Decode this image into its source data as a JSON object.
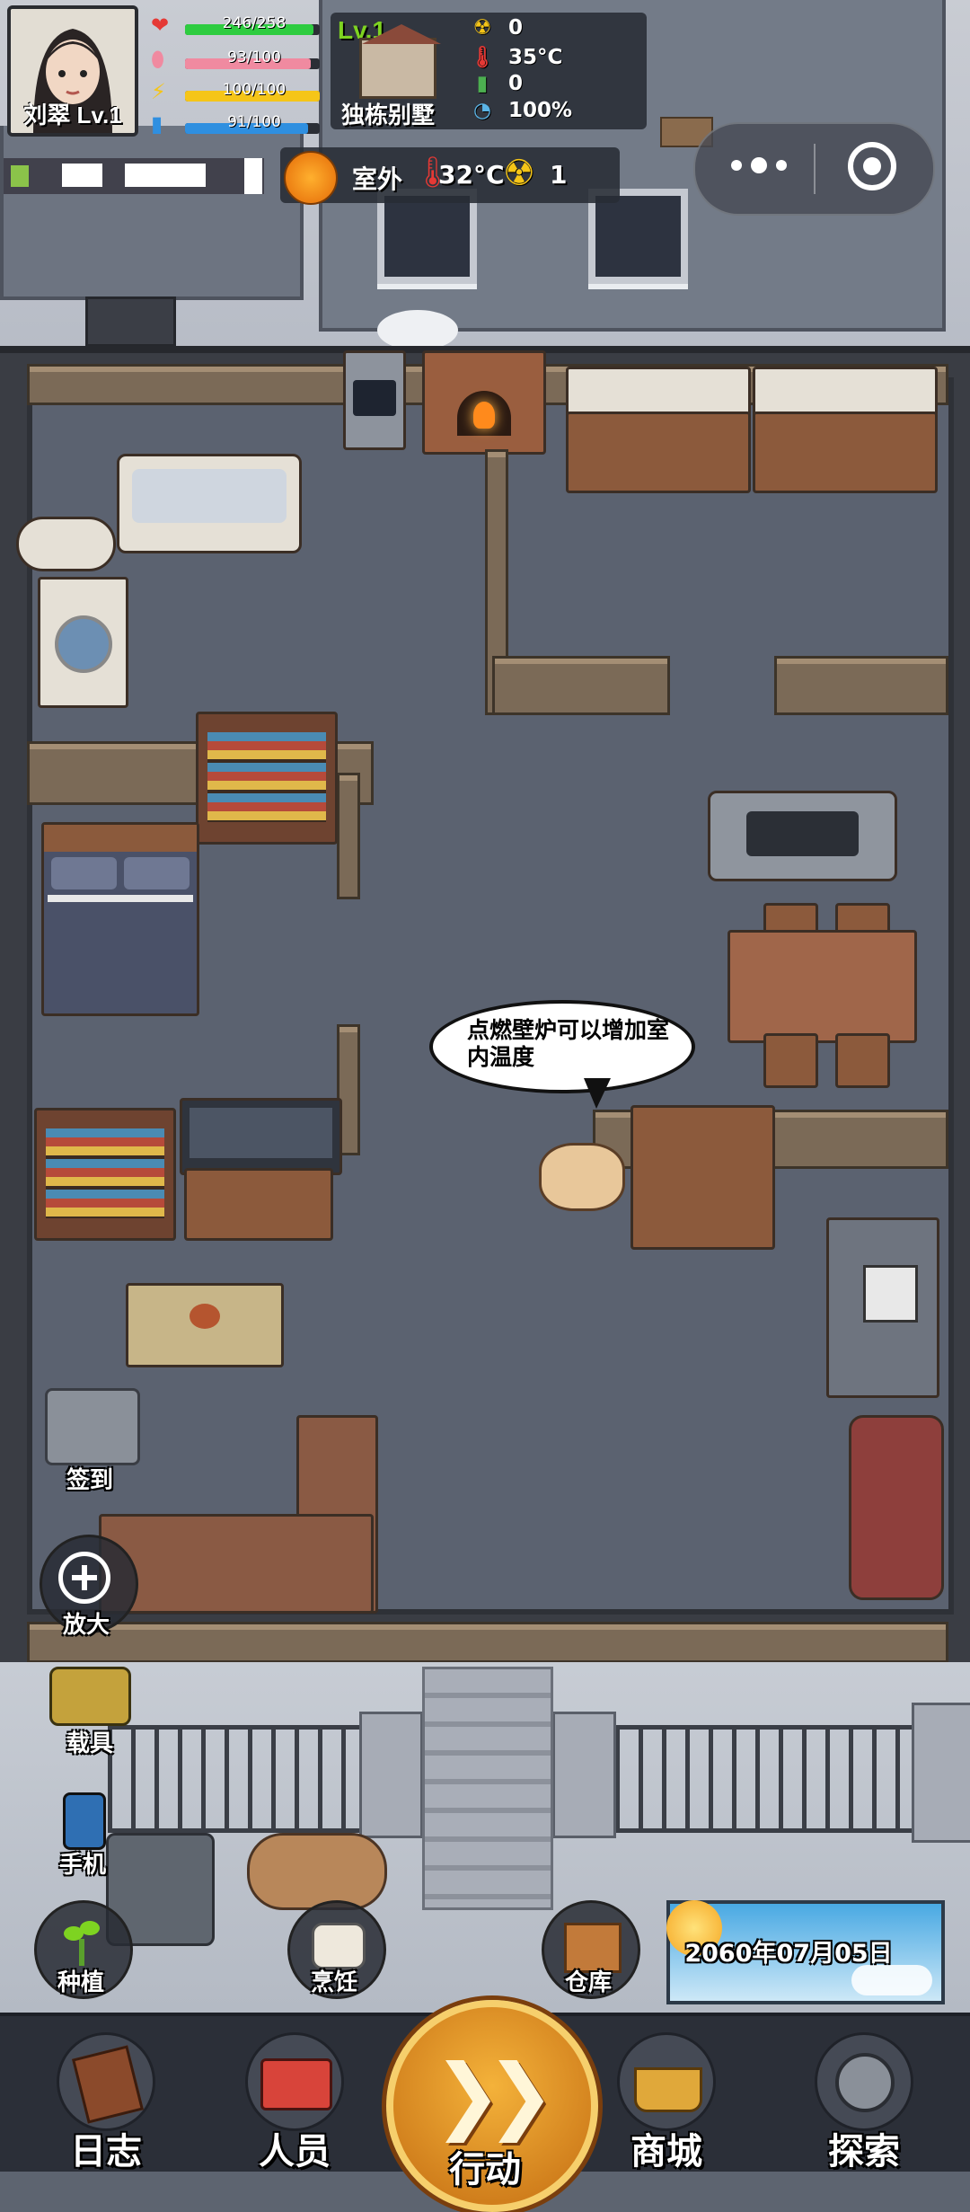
{
  "player": {
    "name_level": "刘翠 Lv.1",
    "stats": [
      {
        "icon": "heart-icon",
        "glyph": "❤",
        "text": "246/258",
        "fraction": 0.953,
        "color": "#2ecc40"
      },
      {
        "icon": "stomach-icon",
        "glyph": "🫃",
        "text": "93/100",
        "fraction": 0.93,
        "color": "#f08aa0"
      },
      {
        "icon": "energy-icon",
        "glyph": "⚡",
        "text": "100/100",
        "fraction": 1.0,
        "color": "#f5c518"
      },
      {
        "icon": "water-icon",
        "glyph": "🧴",
        "text": "91/100",
        "fraction": 0.91,
        "color": "#2f8fe0"
      }
    ]
  },
  "location": {
    "level": "Lv.1",
    "name": "独栋别墅",
    "stats": [
      {
        "icon": "radiation-icon",
        "glyph": "☢",
        "value": "0"
      },
      {
        "icon": "thermometer-icon",
        "glyph": "🌡",
        "value": "35°C"
      },
      {
        "icon": "battery-icon",
        "glyph": "🔋",
        "value": "0"
      },
      {
        "icon": "pie-icon",
        "glyph": "◔",
        "value": "100%"
      }
    ]
  },
  "weather": {
    "label": "室外",
    "temperature": "32°C",
    "radiation": "1"
  },
  "bubble": {
    "text": "点燃壁炉可以增加室内温度"
  },
  "side_buttons": {
    "checkin": "签到",
    "zoom": "放大",
    "vehicle": "载具",
    "phone": "手机",
    "plant": "种植",
    "cook": "烹饪",
    "storage": "仓库"
  },
  "date": "2060年07月05日",
  "nav": {
    "log": "日志",
    "people": "人员",
    "action": "行动",
    "shop": "商城",
    "explore": "探索"
  },
  "colors": {
    "accent_orange": "#f08a14",
    "floor": "#5b6270",
    "level_green": "#7ed321"
  }
}
